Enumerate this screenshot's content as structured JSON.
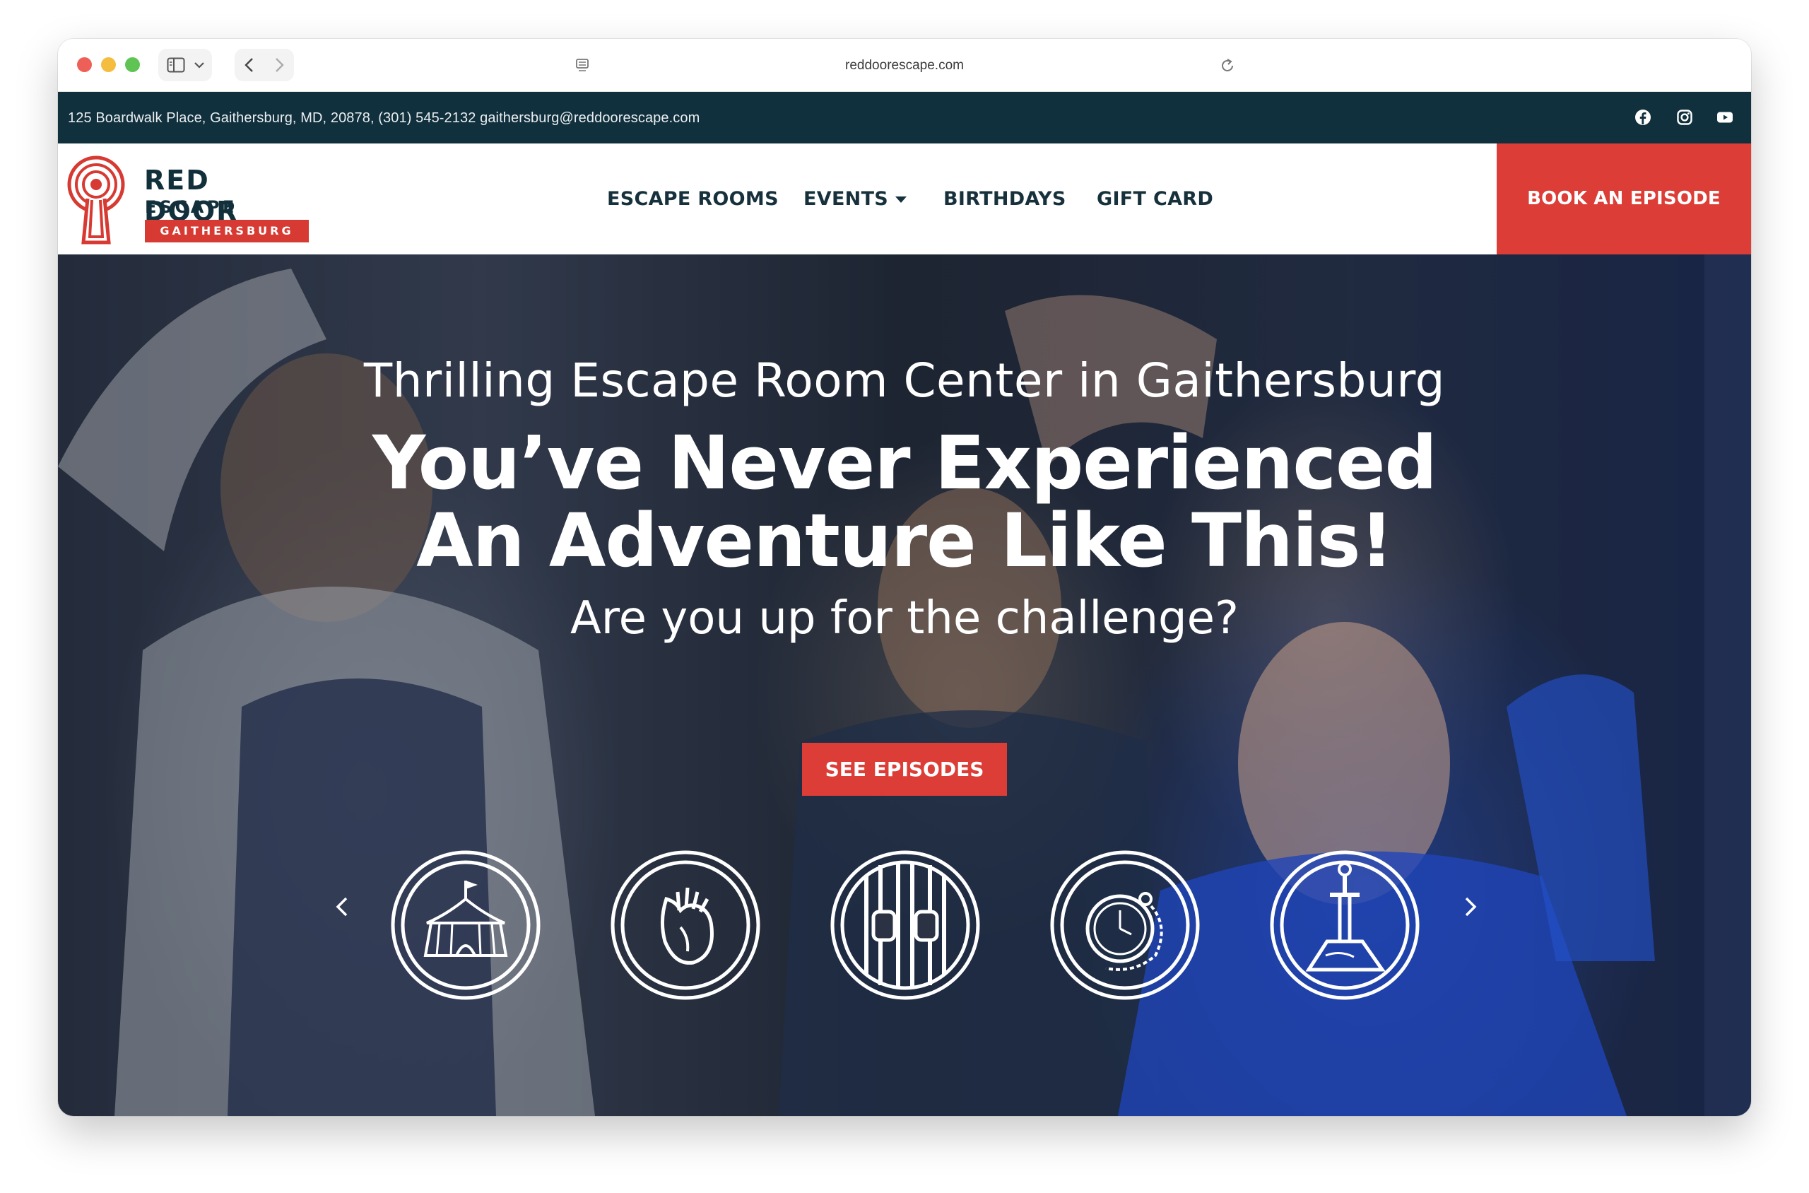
{
  "browser": {
    "url": "reddoorescape.com"
  },
  "infobar": {
    "contact": "125 Boardwalk Place, Gaithersburg, MD, 20878, (301) 545-2132 gaithersburg@reddoorescape.com",
    "social": [
      "facebook-icon",
      "instagram-icon",
      "youtube-icon"
    ]
  },
  "logo": {
    "line1": "RED DOOR",
    "line2": "ESCAPE ROOM",
    "location": "GAITHERSBURG"
  },
  "nav": {
    "items": [
      {
        "label": "ESCAPE ROOMS"
      },
      {
        "label": "EVENTS",
        "has_dropdown": true
      },
      {
        "label": "BIRTHDAYS"
      },
      {
        "label": "GIFT CARD"
      }
    ],
    "book_label": "BOOK AN EPISODE"
  },
  "hero": {
    "kicker": "Thrilling Escape Room Center in Gaithersburg",
    "headline_1": "You’ve Never Experienced",
    "headline_2": "An Adventure Like This!",
    "subline": "Are you up for the challenge?",
    "cta_label": "SEE EPISODES"
  },
  "episodes": {
    "icons": [
      "circus-tent-icon",
      "anatomical-heart-icon",
      "prison-bars-icon",
      "pocket-watch-icon",
      "sword-in-stone-icon"
    ]
  },
  "colors": {
    "brand_red": "#dc3d36",
    "brand_navy": "#11303d",
    "nav_text": "#17313c"
  }
}
